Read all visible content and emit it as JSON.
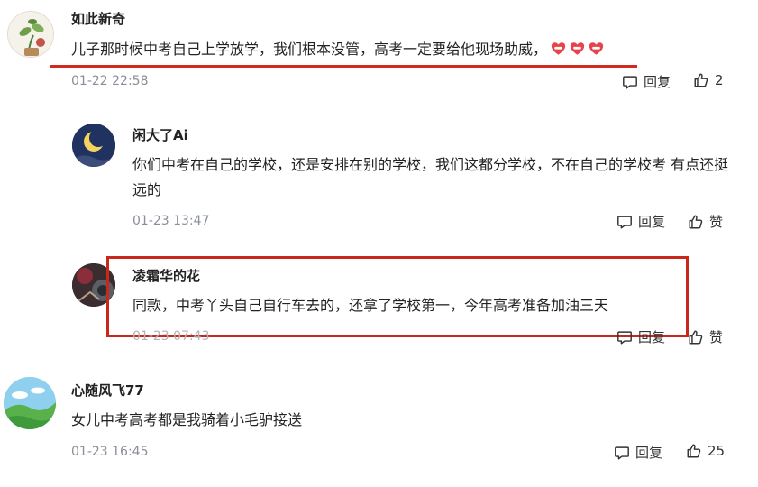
{
  "accent_color": "#d22a1e",
  "comments": [
    {
      "username": "如此新奇",
      "text": "儿子那时候中考自己上学放学，我们根本没管，高考一定要给他现场助威，",
      "emojis": [
        "heart-emoji",
        "heart-emoji",
        "heart-emoji"
      ],
      "time": "01-22 22:58",
      "reply_label": "回复",
      "like_label": "2"
    },
    {
      "username": "闲大了Ai",
      "text": "你们中考在自己的学校，还是安排在别的学校，我们这都分学校，不在自己的学校考 有点还挺远的",
      "time": "01-23 13:47",
      "reply_label": "回复",
      "like_label": "赞"
    },
    {
      "username": "凌霜华的花",
      "text": "同款，中考丫头自己自行车去的，还拿了学校第一，今年高考准备加油三天",
      "time": "01-23 07:43",
      "reply_label": "回复",
      "like_label": "赞"
    },
    {
      "username": "心随风飞77",
      "text": "女儿中考高考都是我骑着小毛驴接送",
      "time": "01-23 16:45",
      "reply_label": "回复",
      "like_label": "25"
    }
  ]
}
